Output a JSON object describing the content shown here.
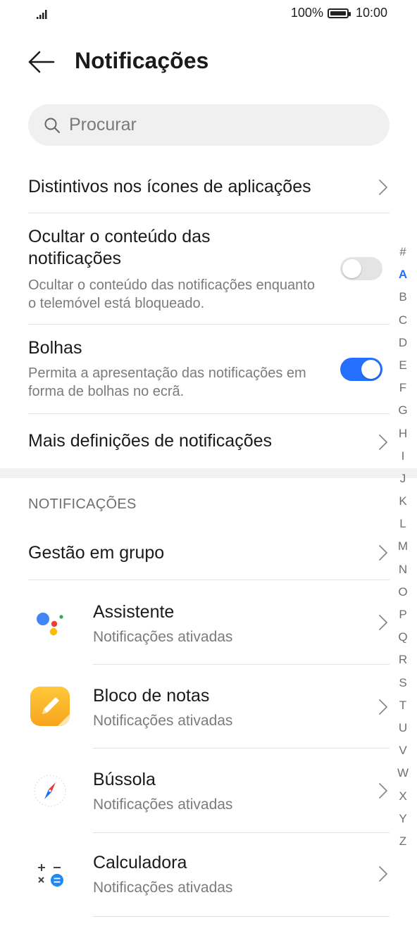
{
  "status_bar": {
    "battery": "100%",
    "battery_level": 1.0,
    "time": "10:00"
  },
  "header": {
    "title": "Notificações"
  },
  "search": {
    "placeholder": "Procurar"
  },
  "settings": {
    "badges": {
      "label": "Distintivos nos ícones de aplicações"
    },
    "hide_content": {
      "label": "Ocultar o conteúdo das notificações",
      "description": "Ocultar o conteúdo das notificações enquanto o telemóvel está bloqueado.",
      "enabled": false
    },
    "bubbles": {
      "label": "Bolhas",
      "description": "Permita a apresentação das notificações em forma de bolhas no ecrã.",
      "enabled": true
    },
    "more": {
      "label": "Mais definições de notificações"
    }
  },
  "notifications_section": {
    "header": "NOTIFICAÇÕES",
    "group_management": "Gestão em grupo",
    "apps": [
      {
        "name": "Assistente",
        "status": "Notificações ativadas",
        "icon": "assistant-icon"
      },
      {
        "name": "Bloco de notas",
        "status": "Notificações ativadas",
        "icon": "notepad-icon"
      },
      {
        "name": "Bússola",
        "status": "Notificações ativadas",
        "icon": "compass-icon"
      },
      {
        "name": "Calculadora",
        "status": "Notificações ativadas",
        "icon": "calculator-icon"
      }
    ]
  },
  "alphabet_index": {
    "letters": [
      "#",
      "A",
      "B",
      "C",
      "D",
      "E",
      "F",
      "G",
      "H",
      "I",
      "J",
      "K",
      "L",
      "M",
      "N",
      "O",
      "P",
      "Q",
      "R",
      "S",
      "T",
      "U",
      "V",
      "W",
      "X",
      "Y",
      "Z"
    ],
    "active": "A"
  },
  "colors": {
    "accent": "#256fff",
    "toggle_off": "#e4e4e4",
    "divider": "#e2e2e2"
  }
}
